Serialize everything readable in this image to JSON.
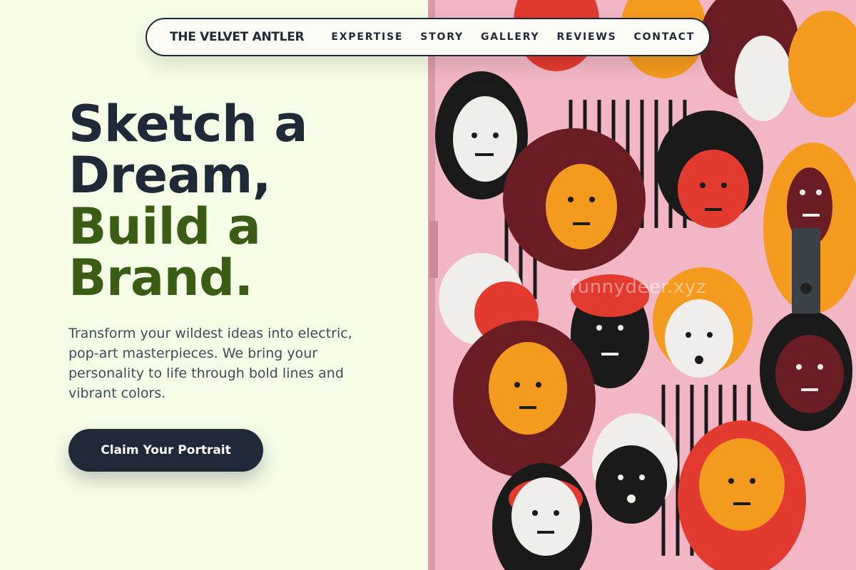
{
  "nav": {
    "brand": "THE VELVET ANTLER",
    "links": [
      "EXPERTISE",
      "STORY",
      "GALLERY",
      "REVIEWS",
      "CONTACT"
    ]
  },
  "hero": {
    "headline_line1": "Sketch a",
    "headline_line2": "Dream,",
    "headline_line3": "Build a",
    "headline_line4": "Brand.",
    "subtext": "Transform your wildest ideas into electric, pop-art masterpieces. We bring your personality to life through bold lines and vibrant colors.",
    "cta_label": "Claim Your Portrait"
  },
  "image": {
    "watermark": "funnydeer.xyz"
  },
  "colors": {
    "background": "#f6fde6",
    "dark": "#1f2937",
    "accent_green": "#3b5c14",
    "mural_pink": "#f2b6c4"
  }
}
